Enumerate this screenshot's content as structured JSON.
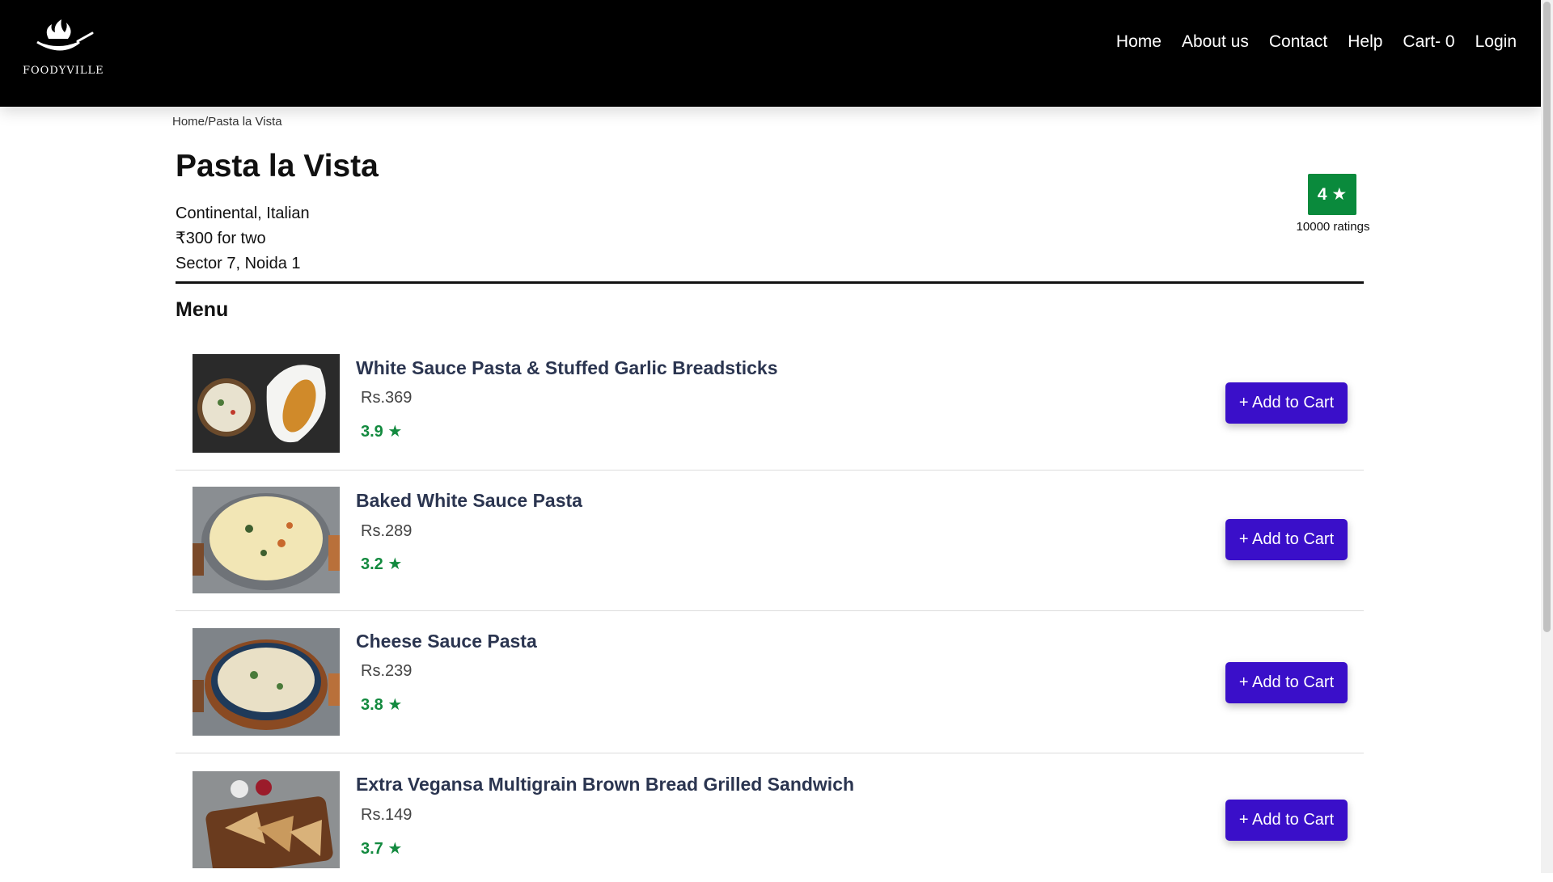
{
  "header": {
    "logo_text": "FOODYVILLE",
    "nav": [
      "Home",
      "About us",
      "Contact",
      "Help",
      "Cart- 0",
      "Login"
    ]
  },
  "breadcrumb": {
    "home": "Home",
    "separator": "/",
    "current": "Pasta la Vista"
  },
  "restaurant": {
    "name": "Pasta la Vista",
    "cuisine": "Continental, Italian",
    "cost": "₹300 for two",
    "location": "Sector 7, Noida 1",
    "rating": "4 ★",
    "rating_count": "10000 ratings"
  },
  "menu": {
    "heading": "Menu",
    "add_label": "+ Add to Cart",
    "items": [
      {
        "name": "White Sauce Pasta & Stuffed Garlic Breadsticks",
        "price": "Rs.369",
        "rating": "3.9 ★"
      },
      {
        "name": "Baked White Sauce Pasta",
        "price": "Rs.289",
        "rating": "3.2 ★"
      },
      {
        "name": "Cheese Sauce Pasta",
        "price": "Rs.239",
        "rating": "3.8 ★"
      },
      {
        "name": "Extra Vegansa Multigrain Brown Bread Grilled Sandwich",
        "price": "Rs.149",
        "rating": "3.7 ★"
      }
    ]
  },
  "colors": {
    "header_bg": "#000000",
    "accent": "#3a0fc9",
    "rating_green": "#0a8a3c"
  }
}
